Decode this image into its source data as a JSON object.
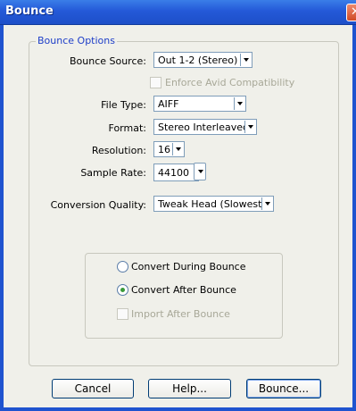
{
  "window": {
    "title": "Bounce",
    "close_glyph": "✕"
  },
  "group": {
    "legend": "Bounce Options"
  },
  "fields": {
    "bounce_source": {
      "label": "Bounce Source:",
      "value": "Out 1-2 (Stereo)"
    },
    "enforce_avid": {
      "label": "Enforce Avid Compatibility",
      "checked": false,
      "enabled": false
    },
    "file_type": {
      "label": "File Type:",
      "value": "AIFF"
    },
    "format": {
      "label": "Format:",
      "value": "Stereo Interleaved"
    },
    "resolution": {
      "label": "Resolution:",
      "value": "16"
    },
    "sample_rate": {
      "label": "Sample Rate:",
      "value": "44100"
    },
    "conversion_quality": {
      "label": "Conversion Quality:",
      "value": "Tweak Head (Slowest)"
    }
  },
  "conversion": {
    "during": {
      "label": "Convert During Bounce",
      "selected": false
    },
    "after": {
      "label": "Convert After Bounce",
      "selected": true
    },
    "import_after": {
      "label": "Import After Bounce",
      "checked": false,
      "enabled": false
    }
  },
  "buttons": {
    "cancel": "Cancel",
    "help": "Help...",
    "bounce": "Bounce..."
  }
}
